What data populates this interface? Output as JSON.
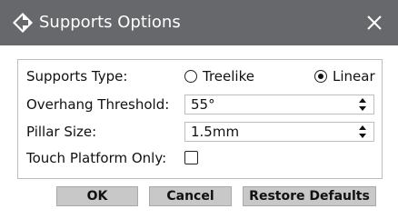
{
  "window": {
    "title": "Supports Options",
    "title_icon": "diamond-arrow-icon",
    "close_icon": "close-icon",
    "titlebar_color": "#67686b"
  },
  "form": {
    "supports_type": {
      "label": "Supports Type:",
      "options": [
        "Treelike",
        "Linear"
      ],
      "selected": "Linear"
    },
    "overhang_threshold": {
      "label": "Overhang Threshold:",
      "value": "55°"
    },
    "pillar_size": {
      "label": "Pillar Size:",
      "value": "1.5mm"
    },
    "touch_platform_only": {
      "label": "Touch Platform Only:",
      "checked": false
    }
  },
  "buttons": {
    "ok": "OK",
    "cancel": "Cancel",
    "restore_defaults": "Restore Defaults"
  }
}
